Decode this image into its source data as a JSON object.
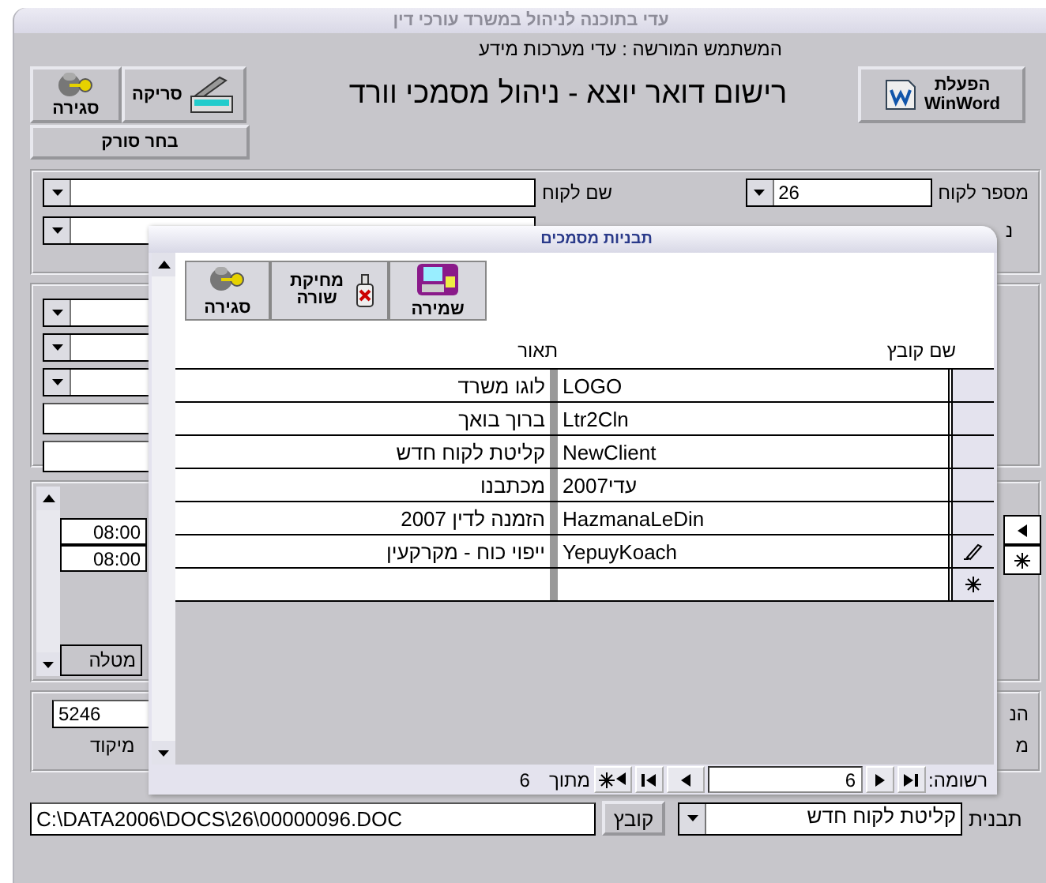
{
  "window": {
    "title": "עדי בתוכנה לניהול במשרד עורכי דין"
  },
  "user_line": "המשתמש המורשה : עדי מערכות מידע",
  "header": {
    "close_button": "סגירה",
    "scan_button": "סריקה",
    "heading": "רישום דואר יוצא - ניהול מסמכי וורד",
    "winword_button": [
      "הפעלת",
      "WinWord"
    ],
    "select_scanner_button": "בחר סורק"
  },
  "client_panel": {
    "client_number_label": "מספר לקוח",
    "client_number": "26",
    "client_name_label": "שם לקוח",
    "row_2_label": "נ"
  },
  "schedule_panel": {
    "times": [
      "08:00",
      "08:00"
    ],
    "column_label": "מטלה"
  },
  "address_panel": {
    "zip_value": "5246",
    "zip_label": "מיקוד",
    "labels": [
      "הנ",
      "מ"
    ]
  },
  "dialog": {
    "title": "תבניות מסמכים",
    "toolbar": [
      {
        "kind": "save",
        "label": "שמירה"
      },
      {
        "kind": "delete",
        "label": "מחיקת שורה"
      },
      {
        "kind": "close",
        "label": "סגירה"
      }
    ],
    "columns": [
      "שם קובץ",
      "תאור"
    ],
    "rows": [
      {
        "file": "LOGO",
        "description": "לוגו משרד",
        "editing": false
      },
      {
        "file": "Ltr2Cln",
        "description": "ברוך בואך",
        "editing": false
      },
      {
        "file": "NewClient",
        "description": "קליטת לקוח חדש",
        "editing": false
      },
      {
        "file": "עדי2007",
        "description": "מכתבנו",
        "editing": false
      },
      {
        "file": "HazmanaLeDin",
        "description": "הזמנה לדין 2007",
        "editing": false
      },
      {
        "file": "YepuyKoach",
        "description": "ייפוי כוח - מקרקעין",
        "editing": true
      }
    ],
    "navigation": {
      "record_label": "רשומה:",
      "record": "6",
      "of_label": "מתוך",
      "total": "6"
    }
  },
  "bottom": {
    "template_label": "תבנית",
    "template": "קליטת לקוח חדש",
    "file_button": "קובץ",
    "file_path": "C:\\DATA2006\\DOCS\\26\\00000096.DOC"
  }
}
